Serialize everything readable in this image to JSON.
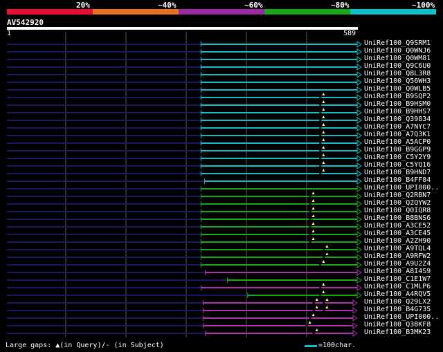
{
  "legend": {
    "labels": [
      "20%",
      "~40%",
      "~60%",
      "~80%",
      "~100%"
    ],
    "colors": [
      "#e8102e",
      "#e87020",
      "#9a2aa0",
      "#18a818",
      "#10c0c8"
    ]
  },
  "query": {
    "name": "AV542920",
    "start_label": "1",
    "end_label": "589"
  },
  "colors": {
    "cyan": "#10c0c8",
    "green": "#18a818",
    "magenta": "#b030b0",
    "navy": "#1a1a60",
    "grid": "#5a5a5a",
    "gap_marker": "#ffff80"
  },
  "hits": [
    {
      "name": "UniRef100_Q9SRM1",
      "color": "cyan",
      "start": 0.553
    },
    {
      "name": "UniRef100_Q0WNJ6",
      "color": "cyan",
      "start": 0.553
    },
    {
      "name": "UniRef100_Q0WM81",
      "color": "cyan",
      "start": 0.553
    },
    {
      "name": "UniRef100_Q9C6U0",
      "color": "cyan",
      "start": 0.553
    },
    {
      "name": "UniRef100_Q8L3R8",
      "color": "cyan",
      "start": 0.553
    },
    {
      "name": "UniRef100_Q56WH3",
      "color": "cyan",
      "start": 0.553
    },
    {
      "name": "UniRef100_Q0WLB5",
      "color": "cyan",
      "start": 0.553
    },
    {
      "name": "UniRef100_B9SQP2",
      "color": "cyan",
      "start": 0.553,
      "gap": 0.902
    },
    {
      "name": "UniRef100_B9HSM0",
      "color": "cyan",
      "start": 0.553,
      "gap": 0.902
    },
    {
      "name": "UniRef100_B9HHS7",
      "color": "cyan",
      "start": 0.553,
      "gap": 0.902
    },
    {
      "name": "UniRef100_Q39834",
      "color": "cyan",
      "start": 0.553,
      "gap": 0.902
    },
    {
      "name": "UniRef100_A7NYC7",
      "color": "cyan",
      "start": 0.553,
      "gap": 0.902
    },
    {
      "name": "UniRef100_A7Q3K1",
      "color": "cyan",
      "start": 0.553,
      "gap": 0.902
    },
    {
      "name": "UniRef100_A5ACP0",
      "color": "cyan",
      "start": 0.553,
      "gap": 0.902
    },
    {
      "name": "UniRef100_B9GGP9",
      "color": "cyan",
      "start": 0.553,
      "gap": 0.902
    },
    {
      "name": "UniRef100_C5Y2Y9",
      "color": "cyan",
      "start": 0.553,
      "gap": 0.902
    },
    {
      "name": "UniRef100_C5YQ16",
      "color": "cyan",
      "start": 0.553,
      "gap": 0.902
    },
    {
      "name": "UniRef100_B9HND7",
      "color": "cyan",
      "start": 0.553,
      "gap": 0.902
    },
    {
      "name": "UniRef100_B4FF84",
      "color": "cyan",
      "start": 0.563
    },
    {
      "name": "UniRef100_UPI000..",
      "color": "green",
      "start": 0.553
    },
    {
      "name": "UniRef100_Q2RBN7",
      "color": "green",
      "start": 0.553,
      "gap": 0.873
    },
    {
      "name": "UniRef100_Q2QYW2",
      "color": "green",
      "start": 0.553,
      "gap": 0.873
    },
    {
      "name": "UniRef100_Q0IQR8",
      "color": "green",
      "start": 0.553,
      "gap": 0.873
    },
    {
      "name": "UniRef100_B8BNS6",
      "color": "green",
      "start": 0.553,
      "gap": 0.873
    },
    {
      "name": "UniRef100_A3CE52",
      "color": "green",
      "start": 0.553,
      "gap": 0.873
    },
    {
      "name": "UniRef100_A3CE45",
      "color": "green",
      "start": 0.553,
      "gap": 0.873
    },
    {
      "name": "UniRef100_A2ZH90",
      "color": "green",
      "start": 0.553,
      "gap": 0.873
    },
    {
      "name": "UniRef100_A9TQL4",
      "color": "green",
      "start": 0.553,
      "gap": 0.912
    },
    {
      "name": "UniRef100_A9RFW2",
      "color": "green",
      "start": 0.553,
      "gap": 0.912
    },
    {
      "name": "UniRef100_A9U2Z4",
      "color": "green",
      "start": 0.553,
      "gap": 0.902
    },
    {
      "name": "UniRef100_A8I4S9",
      "color": "magenta",
      "start": 0.565
    },
    {
      "name": "UniRef100_C1E1W7",
      "color": "green",
      "start": 0.628
    },
    {
      "name": "UniRef100_C1MLP6",
      "color": "magenta",
      "start": 0.553,
      "gap": 0.902
    },
    {
      "name": "UniRef100_A4RQV5",
      "color": "green",
      "start": 0.686,
      "gap": 0.902
    },
    {
      "name": "UniRef100_Q29LX2",
      "color": "magenta",
      "start": 0.559,
      "end": 0.988,
      "gap": 0.883,
      "gap2": 0.912
    },
    {
      "name": "UniRef100_B4G735",
      "color": "magenta",
      "start": 0.559,
      "end": 0.988,
      "gap": 0.883,
      "gap2": 0.912
    },
    {
      "name": "UniRef100_UPI000..",
      "color": "magenta",
      "start": 0.559,
      "end": 0.988,
      "gap": 0.873
    },
    {
      "name": "UniRef100_Q38KF8",
      "color": "magenta",
      "start": 0.559,
      "end": 0.988,
      "gap": 0.863
    },
    {
      "name": "UniRef100_B3MK23",
      "color": "magenta",
      "start": 0.565,
      "end": 0.988,
      "gap": 0.883
    }
  ],
  "footer": {
    "gaps_text": "Large gaps: ▲(in Query)/- (in Subject)",
    "scale_text": "=100char."
  }
}
